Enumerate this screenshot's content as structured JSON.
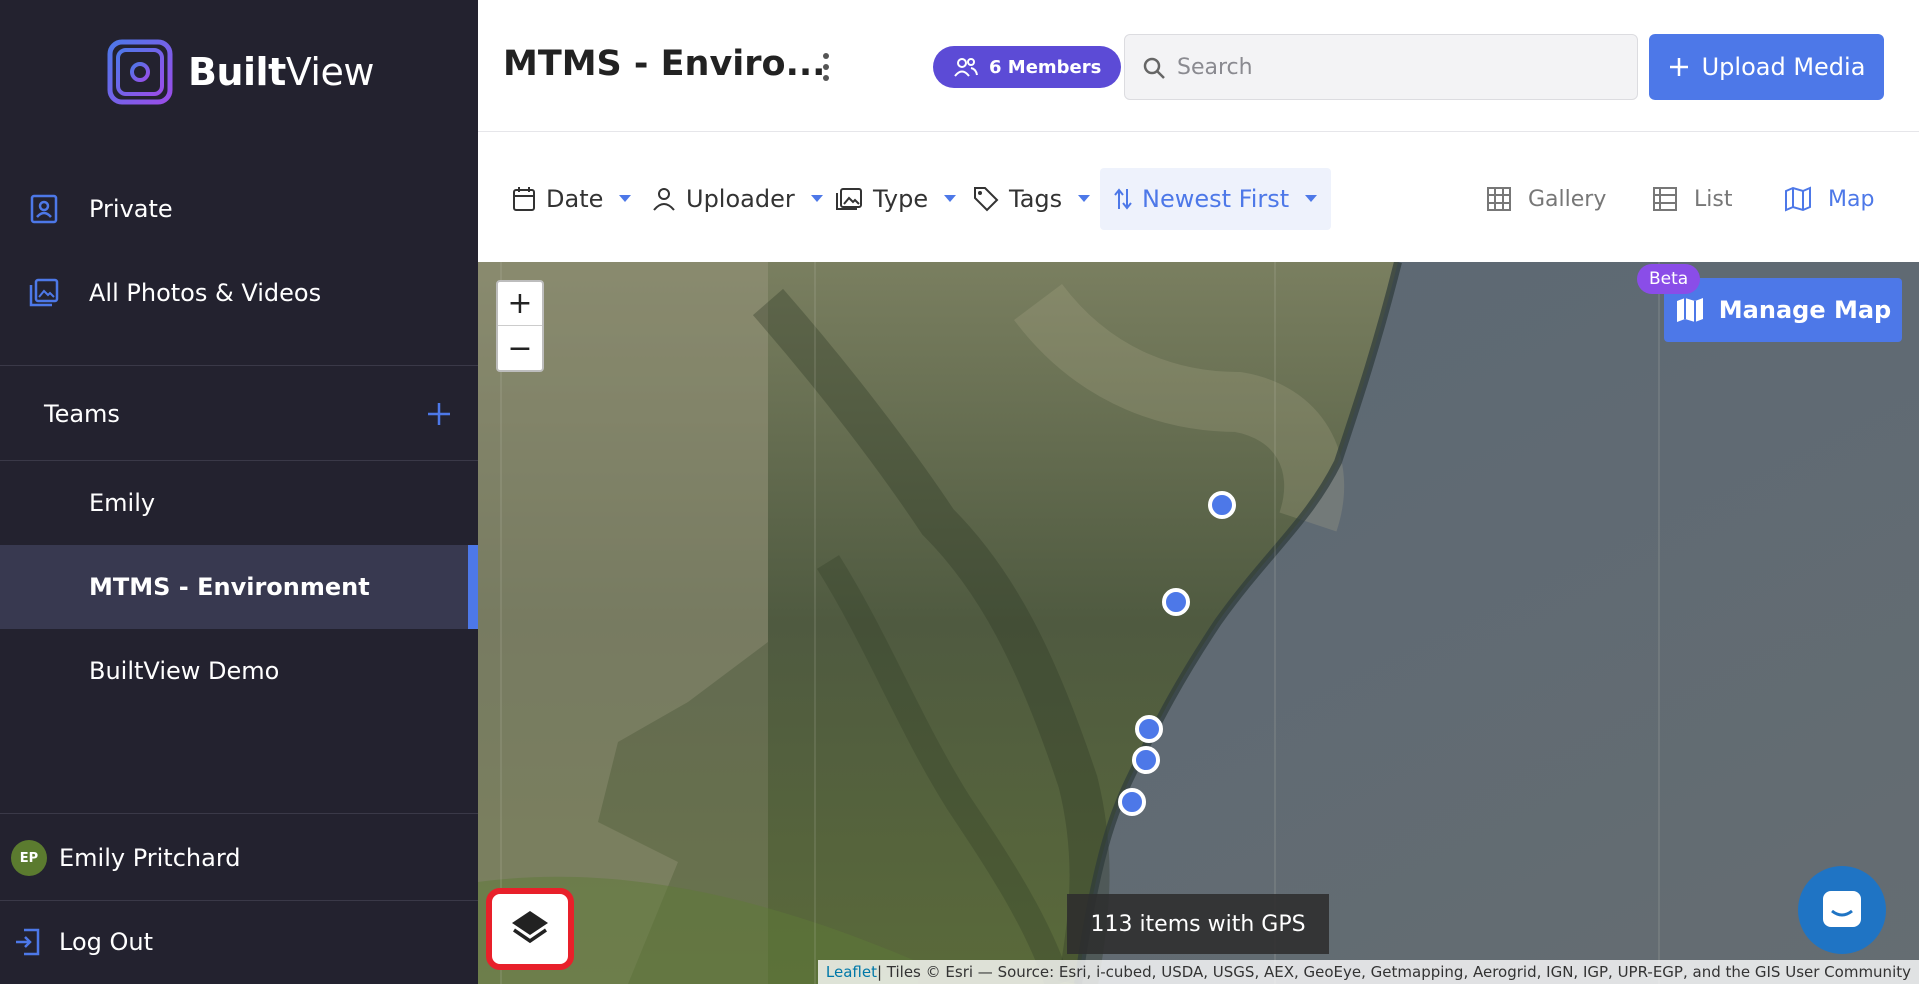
{
  "app": {
    "logo_text_bold": "Built",
    "logo_text_light": "View"
  },
  "sidebar": {
    "nav": [
      {
        "label": "Private",
        "icon": "portrait-icon"
      },
      {
        "label": "All Photos & Videos",
        "icon": "photo-library-icon"
      }
    ],
    "teams_label": "Teams",
    "teams": [
      {
        "label": "Emily",
        "active": false
      },
      {
        "label": "MTMS - Environment",
        "active": true
      },
      {
        "label": "BuiltView Demo",
        "active": false
      }
    ],
    "user": {
      "initials": "EP",
      "name": "Emily Pritchard"
    },
    "logout_label": "Log Out"
  },
  "header": {
    "title": "MTMS - Enviro...",
    "members_label": "6 Members",
    "search_placeholder": "Search",
    "upload_label": "Upload Media"
  },
  "filters": {
    "date": "Date",
    "uploader": "Uploader",
    "type": "Type",
    "tags": "Tags",
    "sort": "Newest First"
  },
  "views": {
    "gallery": "Gallery",
    "list": "List",
    "map": "Map",
    "active": "Map"
  },
  "map": {
    "zoom_in": "+",
    "zoom_out": "−",
    "beta_label": "Beta",
    "manage_label": "Manage Map",
    "gps_count_label": "113 items with GPS",
    "attribution_link": "Leaflet",
    "attribution_text": " | Tiles © Esri — Source: Esri, i-cubed, USDA, USGS, AEX, GeoEye, Getmapping, Aerogrid, IGN, IGP, UPR-EGP, and the GIS User Community",
    "marker_count": 5
  },
  "colors": {
    "accent": "#4d78e8",
    "sidebar_bg": "#23222f",
    "members_badge": "#5c4bd6",
    "beta_badge": "#8a4de8",
    "highlight": "#e8202a"
  }
}
